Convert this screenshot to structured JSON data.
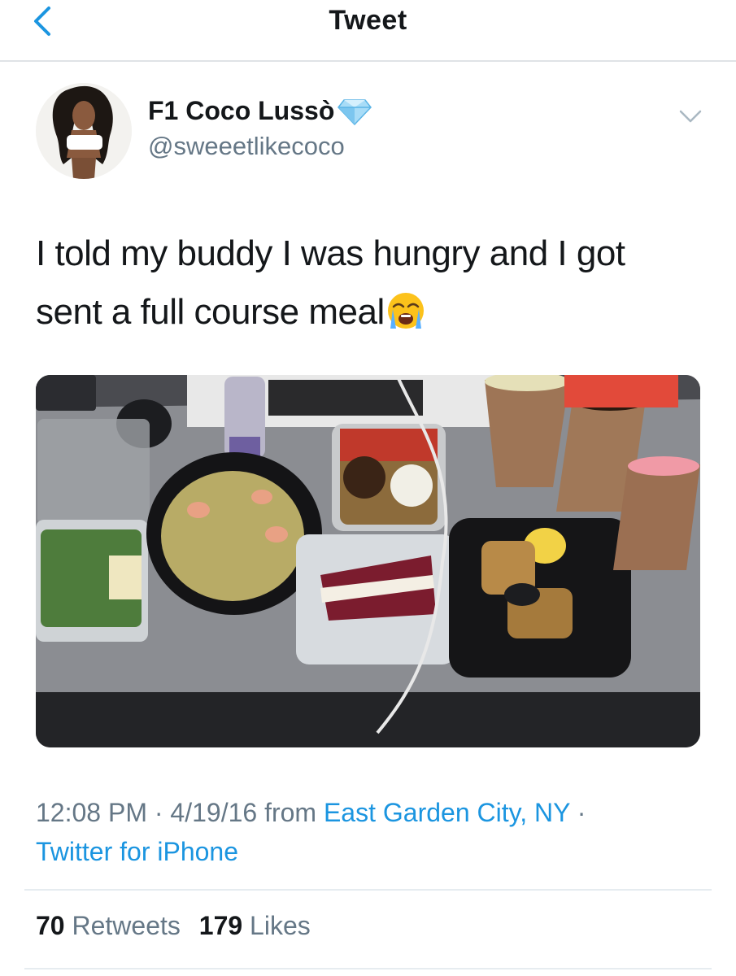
{
  "nav": {
    "title": "Tweet"
  },
  "author": {
    "display_name": "F1 Coco Lussò",
    "handle": "@sweeetlikecoco"
  },
  "tweet": {
    "text_line1": "I told my buddy I was hungry and I got",
    "text_line2": "sent a full course meal"
  },
  "meta": {
    "time": "12:08 PM",
    "sep1": " · ",
    "date": "4/19/16",
    "from_text": " from ",
    "location": "East Garden City, NY",
    "sep2": " · ",
    "source": "Twitter for iPhone"
  },
  "stats": {
    "retweets_count": "70",
    "retweets_label": "Retweets",
    "likes_count": "179",
    "likes_label": "Likes"
  },
  "colors": {
    "link": "#1b95e0",
    "secondary": "#657786",
    "divider": "#e6ecf0"
  }
}
